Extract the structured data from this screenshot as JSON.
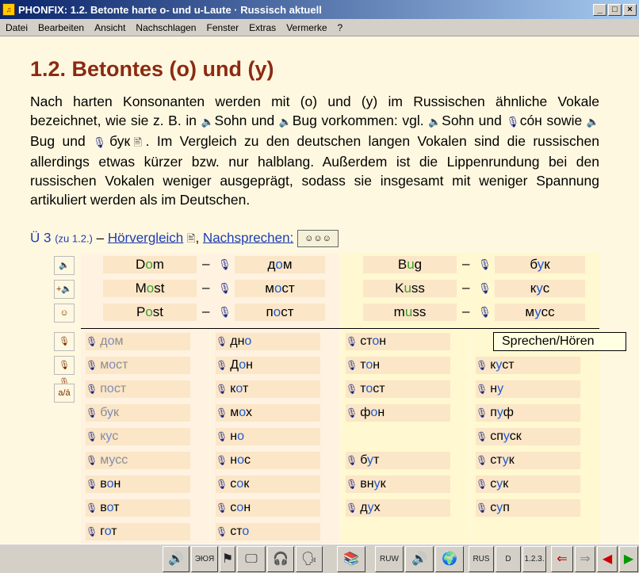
{
  "window": {
    "title": "PHONFIX: 1.2. Betonte harte o- und u-Laute  · Russisch aktuell"
  },
  "menu": [
    "Datei",
    "Bearbeiten",
    "Ansicht",
    "Nachschlagen",
    "Fenster",
    "Extras",
    "Vermerke",
    "?"
  ],
  "lesson": {
    "heading": "1.2. Betontes (o) und (y)",
    "p1": "Nach harten Konsonanten werden mit (o) und (y) im Russischen ähnliche Vokale bezeichnet, wie sie z. B. in ",
    "w_sohn": "Sohn",
    "p2": " und ",
    "w_bug": "Bug",
    "p3": " vorkommen: vgl. ",
    "w_sohn2": "Sohn",
    "p4": " und ",
    "w_son_ru": "cóн",
    "p5": " sowie ",
    "w_bug2": "Bug",
    "p6": " und ",
    "w_buk_ru": "бук",
    "p7": ". Im Vergleich zu den deutschen langen Vokalen sind die russischen allerdings etwas kürzer bzw. nur halblang. Außerdem ist die Lippenrundung bei den russischen Vokalen weniger ausgeprägt, sodass sie insgesamt mit weniger Spannung artikuliert werden als im Deutschen."
  },
  "exercise": {
    "label": "Ü 3",
    "ref": "(zu 1.2.)",
    "dash": "–",
    "hoer": "Hörvergleich",
    "comma": ",",
    "nach": "Nachsprechen:"
  },
  "pairs": [
    {
      "de_a": "D",
      "de_v": "o",
      "de_b": "m",
      "ru_a": "д",
      "ru_v": "о",
      "ru_b": "м"
    },
    {
      "de_a": "M",
      "de_v": "o",
      "de_b": "st",
      "ru_a": "м",
      "ru_v": "о",
      "ru_b": "ст"
    },
    {
      "de_a": "P",
      "de_v": "o",
      "de_b": "st",
      "ru_a": "п",
      "ru_v": "о",
      "ru_b": "ст"
    },
    {
      "de_a": "B",
      "de_v": "u",
      "de_b": "g",
      "ru_a": "б",
      "ru_v": "у",
      "ru_b": "к"
    },
    {
      "de_a": "K",
      "de_v": "u",
      "de_b": "ss",
      "ru_a": "к",
      "ru_v": "у",
      "ru_b": "с"
    },
    {
      "de_a": "m",
      "de_v": "u",
      "de_b": "ss",
      "ru_a": "м",
      "ru_v": "у",
      "ru_b": "сс"
    }
  ],
  "pair_dash": "–",
  "tools": [
    "speaker-icon",
    "record-icon",
    "face-icon",
    "mic-icon",
    "two-mics-icon",
    "transcription-icon"
  ],
  "tool_text": "a/á",
  "words": {
    "col1": [
      {
        "a": "д",
        "v": "о",
        "b": "м",
        "gray": true
      },
      {
        "a": "м",
        "v": "о",
        "b": "ст",
        "gray": true
      },
      {
        "a": "п",
        "v": "о",
        "b": "ст",
        "gray": true
      },
      {
        "a": "б",
        "v": "у",
        "b": "к",
        "gray": true
      },
      {
        "a": "к",
        "v": "у",
        "b": "с",
        "gray": true
      },
      {
        "a": "м",
        "v": "у",
        "b": "сс",
        "gray": true
      },
      {
        "a": "в",
        "v": "о",
        "b": "н",
        "gray": false
      },
      {
        "a": "в",
        "v": "о",
        "b": "т",
        "gray": false
      },
      {
        "a": "г",
        "v": "о",
        "b": "т",
        "gray": false
      }
    ],
    "col2": [
      {
        "a": "дн",
        "v": "о",
        "b": ""
      },
      {
        "a": "Д",
        "v": "о",
        "b": "н"
      },
      {
        "a": "к",
        "v": "о",
        "b": "т"
      },
      {
        "a": "м",
        "v": "о",
        "b": "х"
      },
      {
        "a": "н",
        "v": "о",
        "b": ""
      },
      {
        "a": "н",
        "v": "о",
        "b": "с"
      },
      {
        "a": "с",
        "v": "о",
        "b": "к"
      },
      {
        "a": "с",
        "v": "о",
        "b": "н"
      },
      {
        "a": "ст",
        "v": "о",
        "b": ""
      }
    ],
    "col3": [
      {
        "a": "ст",
        "v": "о",
        "b": "н"
      },
      {
        "a": "т",
        "v": "о",
        "b": "н"
      },
      {
        "a": "т",
        "v": "о",
        "b": "ст"
      },
      {
        "a": "ф",
        "v": "о",
        "b": "н"
      },
      null,
      {
        "a": "б",
        "v": "у",
        "b": "т"
      },
      {
        "a": "вн",
        "v": "у",
        "b": "к"
      },
      {
        "a": "д",
        "v": "у",
        "b": "х"
      }
    ],
    "col4": [
      null,
      {
        "a": "к",
        "v": "у",
        "b": "ст"
      },
      {
        "a": "н",
        "v": "у",
        "b": ""
      },
      {
        "a": "п",
        "v": "у",
        "b": "ф"
      },
      {
        "a": "сп",
        "v": "у",
        "b": "ск"
      },
      {
        "a": "ст",
        "v": "у",
        "b": "к"
      },
      {
        "a": "с",
        "v": "у",
        "b": "к"
      },
      {
        "a": "с",
        "v": "у",
        "b": "п"
      }
    ]
  },
  "tooltip": "Sprechen/Hören",
  "bottom_buttons": [
    {
      "name": "listen-button"
    },
    {
      "name": "keyboard-button",
      "label": "ЭЮЯ"
    },
    {
      "name": "flag-button"
    },
    {
      "name": "speaker-screen-button"
    },
    {
      "name": "head-listen-button"
    },
    {
      "name": "head-speak-button"
    },
    {
      "name": "books-button"
    },
    {
      "name": "dictionary-button",
      "label": "RUW"
    },
    {
      "name": "sound-button"
    },
    {
      "name": "globe-button"
    },
    {
      "name": "rus-button",
      "label": "RUS"
    },
    {
      "name": "de-button",
      "label": "D"
    },
    {
      "name": "list-button",
      "label": "1.2.3."
    },
    {
      "name": "back-history-button"
    },
    {
      "name": "forward-history-button"
    },
    {
      "name": "prev-button"
    },
    {
      "name": "next-button"
    }
  ]
}
